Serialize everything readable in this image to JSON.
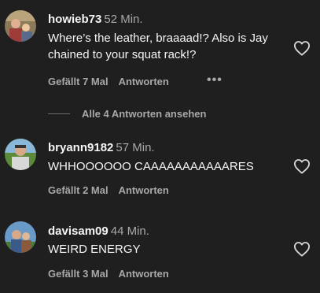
{
  "comments": [
    {
      "username": "howieb73",
      "time": "52 Min.",
      "text": "Where’s the leather, braaaad!? Also is Jay chained to your squat rack!?",
      "likes": "Gefällt 7 Mal",
      "reply": "Antworten",
      "more": "•••",
      "replies_link": "Alle 4 Antworten ansehen"
    },
    {
      "username": "bryann9182",
      "time": "57 Min.",
      "text": "WHHOOOOOO CAAAAAAAAAAARES",
      "likes": "Gefällt 2 Mal",
      "reply": "Antworten"
    },
    {
      "username": "davisam09",
      "time": "44 Min.",
      "text": "WEIRD ENERGY",
      "likes": "Gefällt 3 Mal",
      "reply": "Antworten"
    }
  ],
  "colors": {
    "background": "#1f1f1f",
    "primary_text": "#f5f5f5",
    "secondary_text": "#a8a8a8"
  },
  "icons": {
    "like": "heart-outline-icon",
    "more": "more-dots-icon"
  }
}
